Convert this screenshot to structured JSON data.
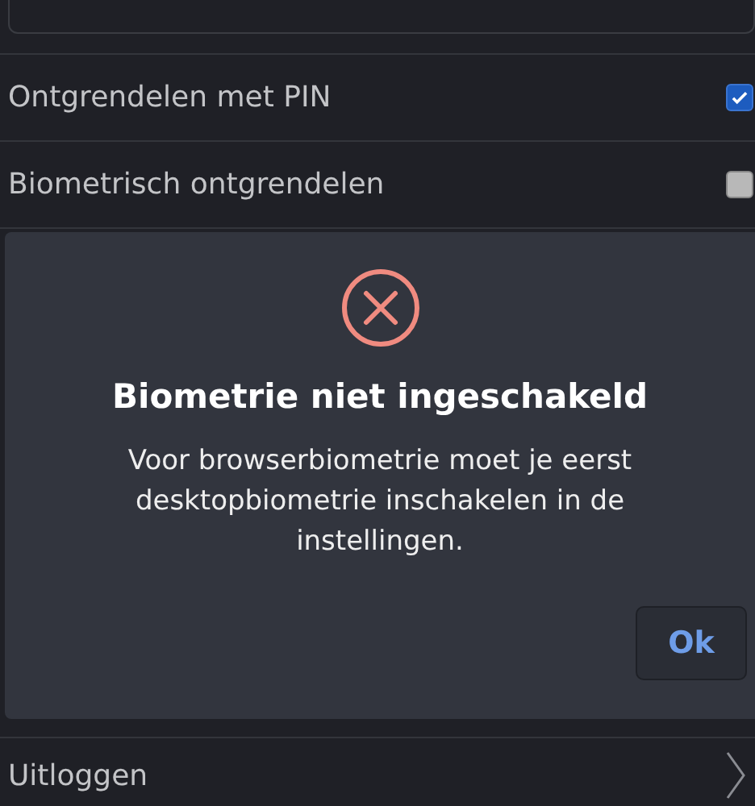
{
  "settings": [
    {
      "label": "Ontgrendelen met PIN",
      "checked": true
    },
    {
      "label": "Biometrisch ontgrendelen",
      "checked": false
    }
  ],
  "dialog": {
    "title": "Biometrie niet ingeschakeld",
    "message": "Voor browserbiometrie moet je eerst desktopbiometrie inschakelen in de instellingen.",
    "button": "Ok"
  },
  "logout": {
    "label": "Uitloggen"
  }
}
